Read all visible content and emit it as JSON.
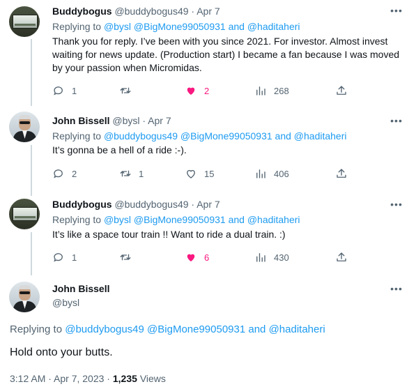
{
  "tweets": [
    {
      "name": "Buddybogus",
      "handle": "@buddybogus49",
      "date": "Apr 7",
      "replying_prefix": "Replying to",
      "replying_to": "@bysl @BigMone99050931 and @haditaheri",
      "text": "Thank you for reply. I’ve been with you since 2021. For investor. Almost invest waiting for news update. (Production start) I became a fan because I was moved by your passion when Micromidas.",
      "replies": "1",
      "retweets": "",
      "likes": "2",
      "liked": true,
      "views": "268"
    },
    {
      "name": "John Bissell",
      "handle": "@bysl",
      "date": "Apr 7",
      "replying_prefix": "Replying to",
      "replying_to": "@buddybogus49 @BigMone99050931 and @haditaheri",
      "text": "It’s gonna be a hell of a ride :-).",
      "replies": "2",
      "retweets": "1",
      "likes": "15",
      "liked": false,
      "views": "406"
    },
    {
      "name": "Buddybogus",
      "handle": "@buddybogus49",
      "date": "Apr 7",
      "replying_prefix": "Replying to",
      "replying_to": "@bysl @BigMone99050931 and @haditaheri",
      "text": "It’s like a space tour train !! Want to ride a dual train. :)",
      "replies": "1",
      "retweets": "",
      "likes": "6",
      "liked": true,
      "views": "430"
    }
  ],
  "main": {
    "name": "John Bissell",
    "handle": "@bysl",
    "replying_prefix": "Replying to",
    "replying_to": "@buddybogus49 @BigMone99050931 and @haditaheri",
    "text": "Hold onto your butts.",
    "time": "3:12 AM · Apr 7, 2023 · ",
    "views_count": "1,235",
    "views_label": "Views"
  },
  "icons": {
    "reply": "reply-icon",
    "retweet": "retweet-icon",
    "like": "heart-icon",
    "views": "views-icon",
    "share": "share-icon",
    "more": "more-icon"
  },
  "colors": {
    "link": "#1d9bf0",
    "like": "#f91880",
    "secondary": "#536471"
  }
}
